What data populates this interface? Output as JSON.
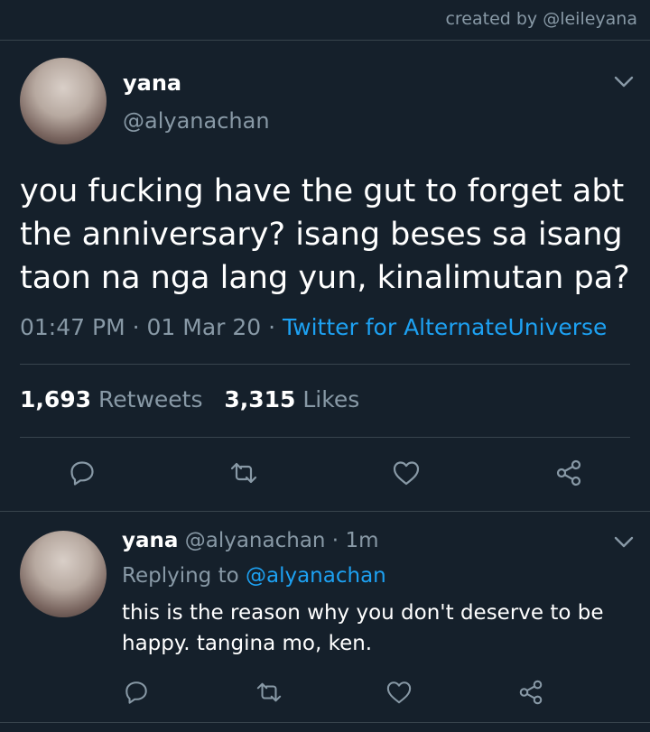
{
  "credit": "created by @leileyana",
  "tweet": {
    "name": "yana",
    "handle": "@alyanachan",
    "text": "you fucking have the gut to forget abt the anniversary? isang beses sa isang taon na nga lang yun, kinalimutan pa?",
    "time": "01:47 PM",
    "sep1": " · ",
    "date": "01 Mar 20",
    "sep2": " · ",
    "source": "Twitter for AlternateUniverse",
    "retweets_count": "1,693",
    "retweets_label": "Retweets",
    "likes_count": "3,315",
    "likes_label": "Likes"
  },
  "reply": {
    "name": "yana",
    "handle": "@alyanachan",
    "sep": " · ",
    "age": "1m",
    "replying_label": "Replying to",
    "replying_to": "@alyanachan",
    "text": "this is the reason why you don't deserve to be happy. tangina mo, ken."
  },
  "icons": {
    "reply": "reply-icon",
    "retweet": "retweet-icon",
    "like": "heart-icon",
    "share": "share-icon",
    "menu": "chevron-down-icon"
  },
  "colors": {
    "background": "#15202b",
    "secondary_text": "#8899a6",
    "link": "#1da1f2",
    "divider": "#38444d"
  }
}
